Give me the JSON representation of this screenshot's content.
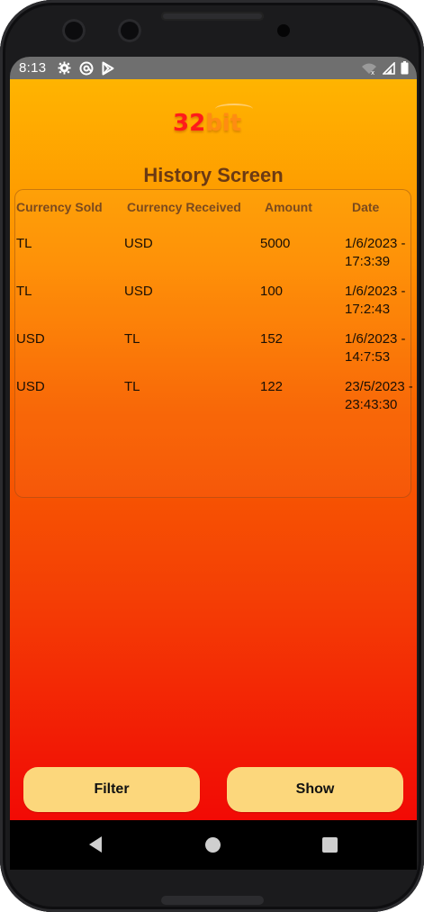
{
  "status_bar": {
    "time": "8:13",
    "icons": [
      "gear-icon",
      "at-sign-icon",
      "play-store-icon"
    ],
    "right_icons": [
      "wifi-icon",
      "signal-icon",
      "battery-icon"
    ]
  },
  "logo": {
    "number": "32",
    "word": "bit"
  },
  "title": "History Screen",
  "table": {
    "headers": [
      "Currency Sold",
      "Currency Received",
      "Amount",
      "Date"
    ],
    "rows": [
      {
        "sold": "TL",
        "received": "USD",
        "amount": "5000",
        "date_line1": "1/6/2023 -",
        "date_line2": "17:3:39"
      },
      {
        "sold": "TL",
        "received": "USD",
        "amount": "100",
        "date_line1": "1/6/2023 -",
        "date_line2": "17:2:43"
      },
      {
        "sold": "USD",
        "received": "TL",
        "amount": "152",
        "date_line1": "1/6/2023 -",
        "date_line2": "14:7:53"
      },
      {
        "sold": "USD",
        "received": "TL",
        "amount": "122",
        "date_line1": "23/5/2023 -",
        "date_line2": "23:43:30"
      }
    ]
  },
  "buttons": {
    "filter": "Filter",
    "show": "Show"
  },
  "colors": {
    "gradient_top": "#ffb400",
    "gradient_bottom": "#f20a05",
    "button_bg": "#fcd77c",
    "header_text": "#7a4a1e",
    "title_text": "#6b3a14"
  }
}
